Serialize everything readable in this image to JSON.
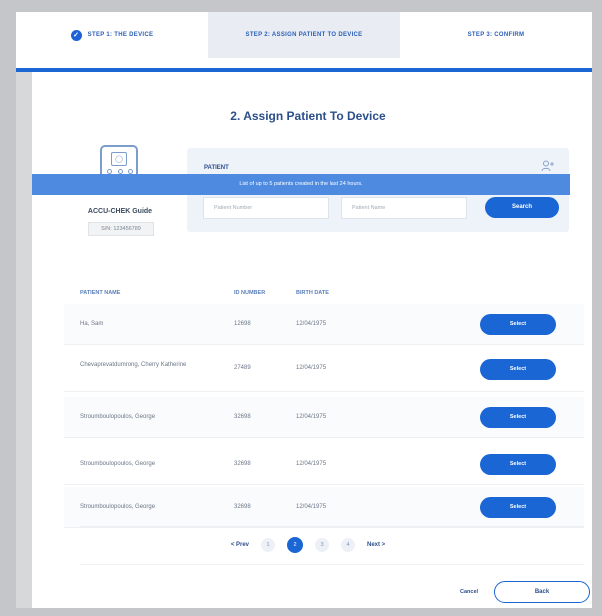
{
  "stepper": {
    "steps": [
      {
        "label": "STEP 1: THE DEVICE",
        "state": "done"
      },
      {
        "label": "STEP 2: ASSIGN PATIENT TO DEVICE",
        "state": "active"
      },
      {
        "label": "STEP 3: CONFIRM",
        "state": "upcoming"
      }
    ]
  },
  "page": {
    "title": "2. Assign Patient To Device"
  },
  "device": {
    "name": "ACCU-CHEK Guide",
    "serial": "S/N: 123456789",
    "icon": "glucose-meter-icon"
  },
  "patient_search": {
    "label": "PATIENT",
    "patient_number_placeholder": "Patient Number",
    "patient_name_placeholder": "Patient Name",
    "search_label": "Search",
    "add_icon": "add-user-icon"
  },
  "info_bar": {
    "text": "List of up to 5 patients created in the last 24 hours."
  },
  "table": {
    "headers": {
      "name": "PATIENT NAME",
      "id": "ID NUMBER",
      "birth": "BIRTH DATE"
    },
    "rows": [
      {
        "name": "Ha, Sam",
        "id": "12698",
        "birth": "12/04/1975",
        "action": "Select"
      },
      {
        "name": "Chevaprevatdumrong, Cherry Katherine",
        "id": "27489",
        "birth": "12/04/1975",
        "action": "Select"
      },
      {
        "name": "Stroumboulopoulos, George",
        "id": "32698",
        "birth": "12/04/1975",
        "action": "Select"
      },
      {
        "name": "Stroumboulopoulos, George",
        "id": "32698",
        "birth": "12/04/1975",
        "action": "Select"
      },
      {
        "name": "Stroumboulopoulos, George",
        "id": "32698",
        "birth": "12/04/1975",
        "action": "Select"
      }
    ]
  },
  "pagination": {
    "prev": "< Prev",
    "next": "Next >",
    "pages": [
      "1",
      "2",
      "3",
      "4"
    ],
    "current": "2"
  },
  "footer": {
    "cancel": "Cancel",
    "back": "Back"
  },
  "colors": {
    "primary": "#1a66d4",
    "info_bar": "#4e8be0",
    "panel": "#eef3fa"
  }
}
